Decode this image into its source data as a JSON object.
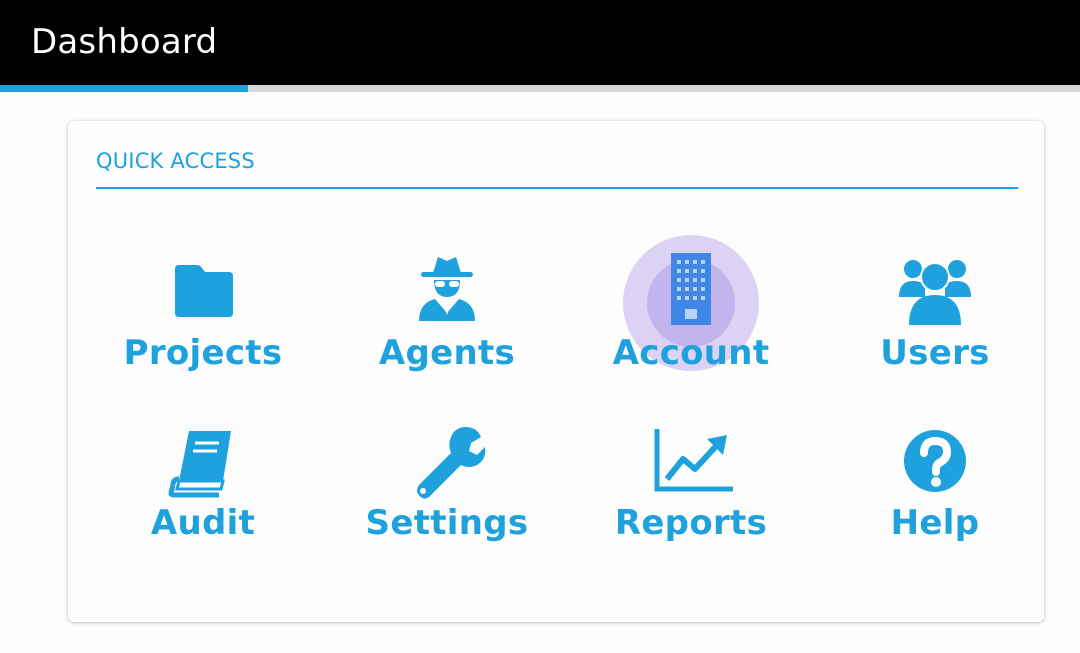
{
  "header": {
    "title": "Dashboard"
  },
  "progress": {
    "percent": 23
  },
  "quick_access": {
    "title": "QUICK ACCESS",
    "items": [
      {
        "label": "Projects",
        "icon": "folder-icon"
      },
      {
        "label": "Agents",
        "icon": "spy-agent-icon"
      },
      {
        "label": "Account",
        "icon": "building-icon",
        "state": "pressed"
      },
      {
        "label": "Users",
        "icon": "users-group-icon"
      },
      {
        "label": "Audit",
        "icon": "book-icon"
      },
      {
        "label": "Settings",
        "icon": "wrench-icon"
      },
      {
        "label": "Reports",
        "icon": "line-chart-icon"
      },
      {
        "label": "Help",
        "icon": "question-circle-icon"
      }
    ]
  },
  "colors": {
    "accent": "#1ea1dc",
    "header_bg": "#000000",
    "track": "#d9d9d9",
    "ripple": "#a38ce6"
  }
}
